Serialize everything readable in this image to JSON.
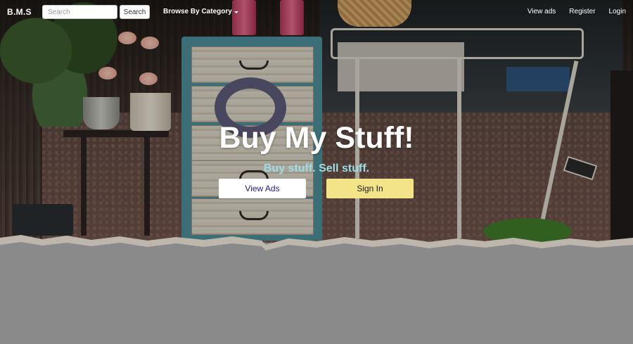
{
  "navbar": {
    "brand": "B.M.S",
    "search_placeholder": "Search",
    "search_button": "Search",
    "category_dropdown": "Browse By Category",
    "links": [
      "View ads",
      "Register",
      "Login"
    ]
  },
  "hero": {
    "headline": "Buy My Stuff!",
    "tagline": "Buy stuff. Sell stuff.",
    "primary_button": "View Ads",
    "secondary_button": "Sign In"
  },
  "colors": {
    "tagline": "#9fdde6",
    "signin_button": "#f3e389",
    "view_ads_text": "#1a1a8a",
    "page_background": "#8a8a8a"
  }
}
